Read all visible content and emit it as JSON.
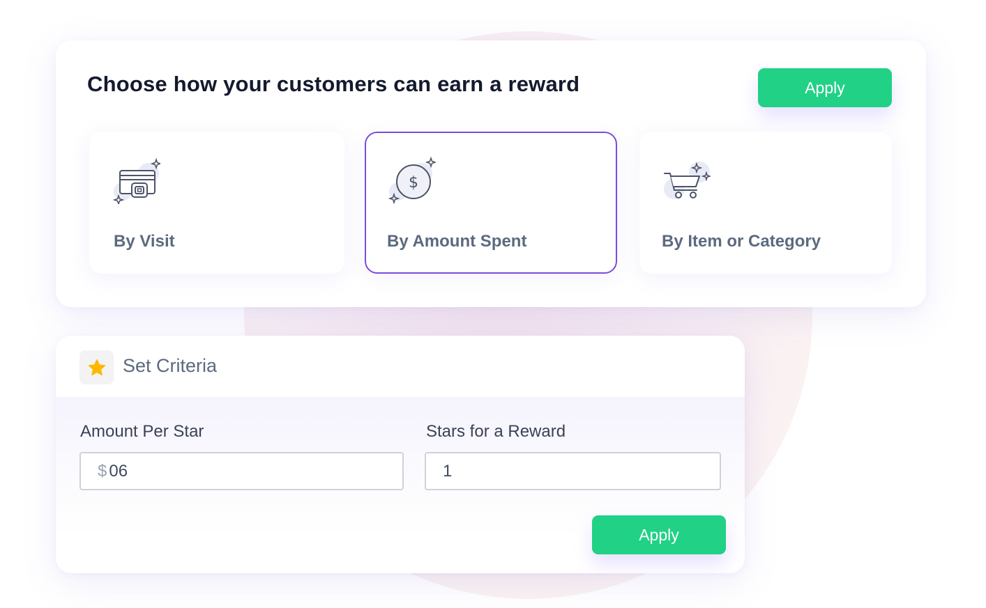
{
  "header": {
    "title": "Choose how your customers can earn a reward",
    "apply_label": "Apply"
  },
  "options": [
    {
      "label": "By Visit",
      "icon": "credit-card-icon",
      "selected": false
    },
    {
      "label": "By Amount Spent",
      "icon": "dollar-coin-icon",
      "selected": true
    },
    {
      "label": "By Item or Category",
      "icon": "shopping-cart-icon",
      "selected": false
    }
  ],
  "criteria": {
    "title": "Set Criteria",
    "icon": "star-icon",
    "amount_per_star": {
      "label": "Amount Per Star",
      "currency": "$",
      "value": "06"
    },
    "stars_for_reward": {
      "label": "Stars for a Reward",
      "value": "1"
    },
    "apply_label": "Apply"
  },
  "colors": {
    "accent_green": "#21d186",
    "selected_border": "#7b4bdc",
    "star": "#ffb800",
    "title_text": "#141a2e",
    "muted_text": "#5c6a7e"
  }
}
